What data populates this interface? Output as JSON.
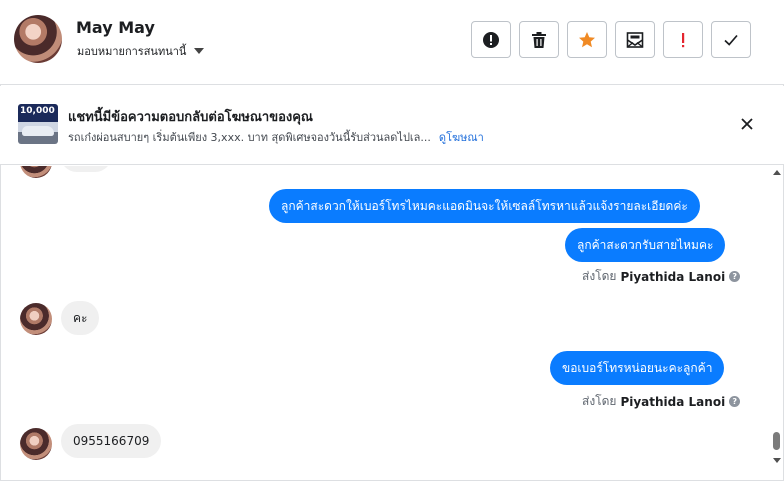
{
  "header": {
    "name": "May May",
    "subtitle": "มอบหมายการสนทนานี้",
    "actions": [
      {
        "name": "alert-icon",
        "label": "!"
      },
      {
        "name": "trash-icon",
        "label": ""
      },
      {
        "name": "star-icon",
        "label": ""
      },
      {
        "name": "envelope-icon",
        "label": ""
      },
      {
        "name": "exclamation-icon",
        "label": "!"
      },
      {
        "name": "checkmark-icon",
        "label": ""
      }
    ]
  },
  "ad": {
    "thumb_text": "10,000",
    "title": "แชทนี้มีข้อความตอบกลับต่อโฆษณาของคุณ",
    "description": "รถเก๋งผ่อนสบายๆ เริ่มต้นเพียง 3,xxx. บาท สุดพิเศษจองวันนี้รับส่วนลดไปเล...",
    "link": "ดูโฆษณา"
  },
  "messages": {
    "out1": "ลูกค้าสะดวกให้เบอร์โทรไหมคะแอดมินจะให้เซลล์โทรหาแล้วแจ้งรายละเอียดค่ะ",
    "out2": "ลูกค้าสะดวกรับสายไหมคะ",
    "sent_by_prefix": "ส่งโดย",
    "sender": "Piyathida Lanoi",
    "in1": "คะ",
    "out3": "ขอเบอร์โทรหน่อยนะคะลูกค้า",
    "in2": "0955166709"
  },
  "colors": {
    "accent": "#0a7cff",
    "star": "#f08a24",
    "danger": "#e4252f"
  }
}
